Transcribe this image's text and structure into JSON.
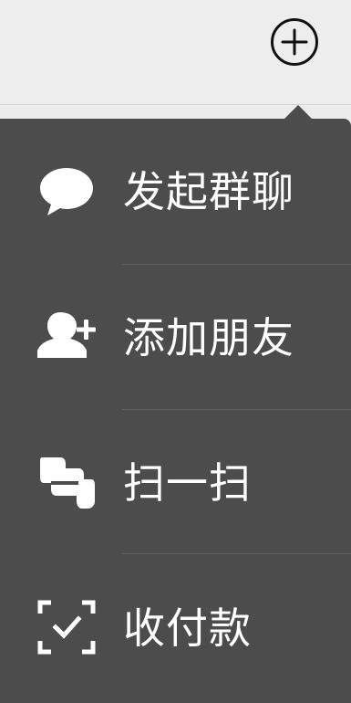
{
  "menu": {
    "items": [
      {
        "label": "发起群聊",
        "icon": "chat-bubble-icon"
      },
      {
        "label": "添加朋友",
        "icon": "add-friend-icon"
      },
      {
        "label": "扫一扫",
        "icon": "scan-icon"
      },
      {
        "label": "收付款",
        "icon": "payment-icon"
      }
    ]
  },
  "colors": {
    "topbar_bg": "#ededed",
    "menu_bg": "#4c4c4c",
    "text": "#ffffff",
    "divider": "#5f5f5f"
  }
}
